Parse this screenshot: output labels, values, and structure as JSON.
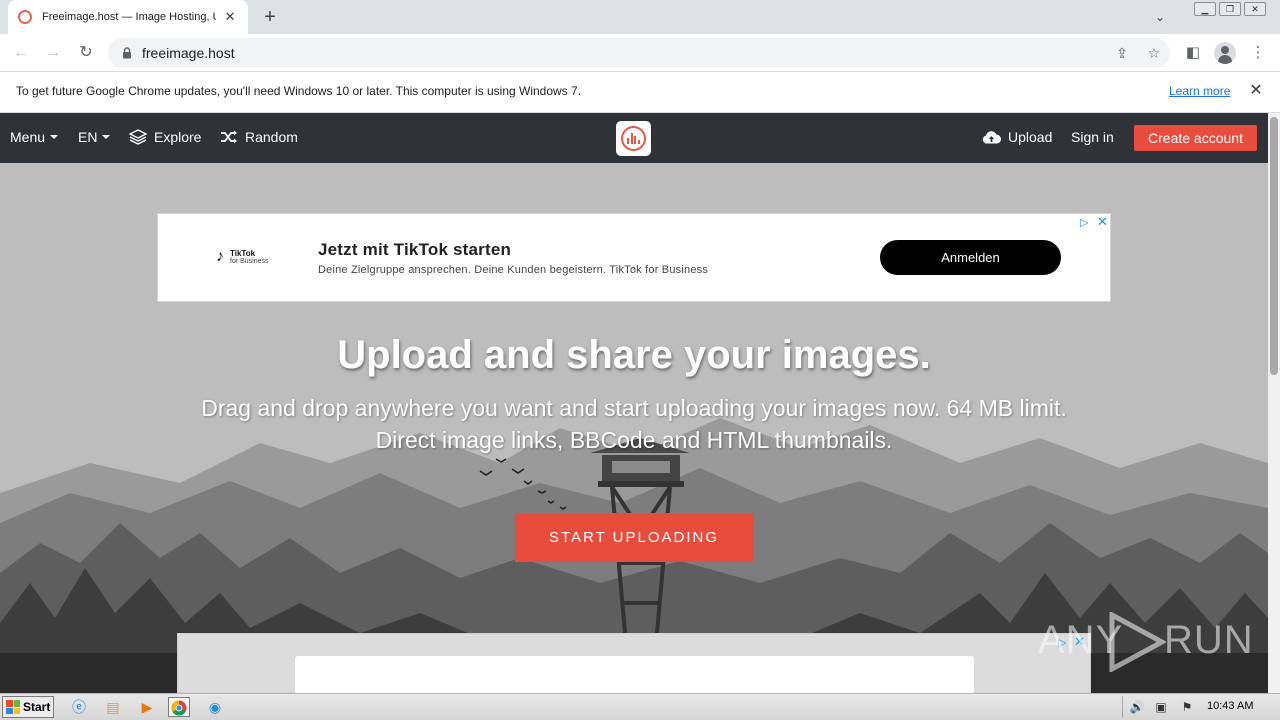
{
  "browser": {
    "tab": {
      "title": "Freeimage.host — Image Hosting, U"
    },
    "url": "freeimage.host",
    "infobar": {
      "message": "To get future Google Chrome updates, you'll need Windows 10 or later. This computer is using Windows 7.",
      "link": "Learn more"
    }
  },
  "site": {
    "nav": {
      "menu": "Menu",
      "lang": "EN",
      "explore": "Explore",
      "random": "Random",
      "upload": "Upload",
      "signin": "Sign in",
      "create": "Create account"
    },
    "ad_top": {
      "brand": "TikTok",
      "brand_sub": "for Business",
      "title": "Jetzt mit TikTok starten",
      "subtitle": "Deine Zielgruppe ansprechen. Deine Kunden begeistern. TikTok for Business",
      "button": "Anmelden"
    },
    "hero": {
      "title": "Upload and share your images.",
      "line1": "Drag and drop anywhere you want and start uploading your images now. 64 MB limit.",
      "line2": "Direct image links, BBCode and HTML thumbnails.",
      "button": "START UPLOADING"
    }
  },
  "watermark": {
    "left": "ANY",
    "right": "RUN"
  },
  "taskbar": {
    "start": "Start",
    "clock": "10:43 AM"
  },
  "colors": {
    "accent": "#e84c3d",
    "header_bg": "#2f3237",
    "ad_button": "#000000"
  },
  "icons": {
    "explore": "layers-icon",
    "random": "shuffle-icon",
    "upload": "cloud-upload-icon"
  }
}
